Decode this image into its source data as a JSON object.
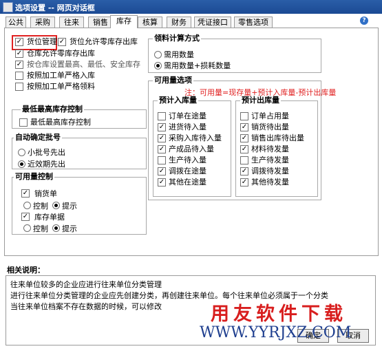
{
  "window": {
    "title": "选项设置 -- 网页对话框"
  },
  "tabs": [
    "公共",
    "采购",
    "往来",
    "销售",
    "库存",
    "核算",
    "财务",
    "凭证接口",
    "零售选项"
  ],
  "stock_options": [
    {
      "label": "货位管理",
      "checked": true
    },
    {
      "label": "货位允许零库存出库",
      "checked": true
    },
    {
      "label": "仓库允许零库存出库",
      "checked": true
    },
    {
      "label": "按仓库设置最高、最低、安全库存",
      "checked": true
    },
    {
      "label": "按照加工单严格入库",
      "checked": false
    },
    {
      "label": "按照加工单严格领料",
      "checked": false
    }
  ],
  "max_stock_group": {
    "title": "最低最高库存控制",
    "checkbox": "最低最高库存控制"
  },
  "auto_batch_group": {
    "title": "自动确定批号",
    "opt1": "小批号先出",
    "opt2": "近效期先出"
  },
  "available_control_group": {
    "title": "可用量控制",
    "item1": "销货单",
    "item2": "库存单据",
    "control": "控制",
    "hint": "提示"
  },
  "picking_calc_group": {
    "title": "领料计算方式",
    "opt1": "需用数量",
    "opt2": "需用数量+损耗数量"
  },
  "available_options": {
    "title": "可用量选项",
    "note": "注：可用量=现存量+预计入库量-预计出库量",
    "incoming_title": "预计入库量",
    "incoming": [
      {
        "label": "订单在途量",
        "checked": false
      },
      {
        "label": "进货待入量",
        "checked": true
      },
      {
        "label": "采购入库待入量",
        "checked": true
      },
      {
        "label": "产成品待入量",
        "checked": true
      },
      {
        "label": "生产待入量",
        "checked": false
      },
      {
        "label": "调拨在途量",
        "checked": true
      },
      {
        "label": "其他在途量",
        "checked": true
      }
    ],
    "outgoing_title": "预计出库量",
    "outgoing": [
      {
        "label": "订单占用量",
        "checked": false
      },
      {
        "label": "销货待出量",
        "checked": true
      },
      {
        "label": "销售出库待出量",
        "checked": true
      },
      {
        "label": "材料待发量",
        "checked": true
      },
      {
        "label": "生产待发量",
        "checked": false
      },
      {
        "label": "调拨待发量",
        "checked": true
      },
      {
        "label": "其他待发量",
        "checked": true
      }
    ]
  },
  "description": {
    "title": "相关说明：",
    "lines": [
      "往来单位较多的企业应进行往来单位分类管理",
      "进行往来单位分类管理的企业应先创建分类，再创建往来单位。每个往来单位必须属于一个分类",
      "当往来单位档案不存在数据的时候，可以修改"
    ]
  },
  "buttons": {
    "ok": "确定",
    "cancel": "取消"
  },
  "watermark": {
    "line1": "用友软件下载",
    "line2": "WWW.YYRJXZ.COM"
  },
  "colors": {
    "highlight": "#e02020",
    "titlebar": "#2a5ea8",
    "note": "#e02020"
  }
}
